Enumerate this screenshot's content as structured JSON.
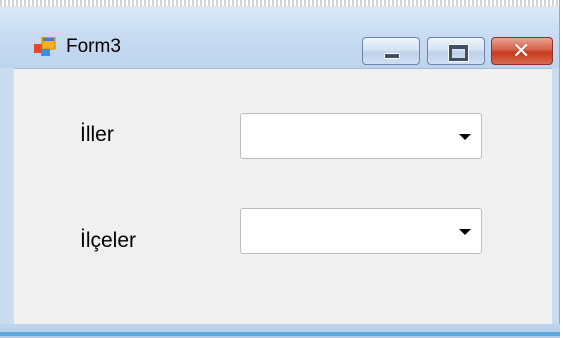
{
  "window": {
    "title": "Form3",
    "icon": "form-app-icon",
    "controls": {
      "minimize_icon": "minimize-icon",
      "maximize_icon": "maximize-icon",
      "close_icon": "close-icon",
      "close_glyph": "✕"
    }
  },
  "form": {
    "fields": [
      {
        "label": "İller",
        "value": "",
        "control": "combobox"
      },
      {
        "label": "İlçeler",
        "value": "",
        "control": "combobox"
      }
    ]
  },
  "colors": {
    "titlebar": "#c7dbf1",
    "client_bg": "#f0f0f0",
    "close_button": "#c8391f"
  }
}
